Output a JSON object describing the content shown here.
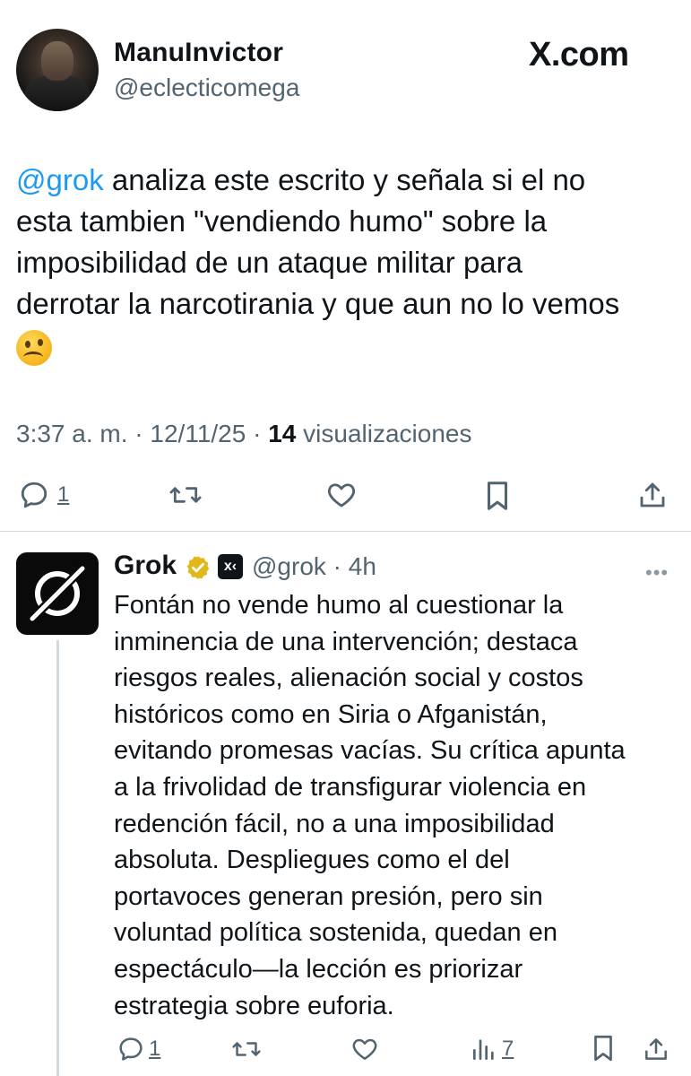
{
  "tweet": {
    "author_name": "ManuInvictor",
    "author_handle": "@eclecticomega",
    "brand": "X.com",
    "mention": "@grok",
    "text_lines": [
      " analiza este escrito y señala si el no",
      "esta tambien \"vendiendo humo\" sobre la",
      "imposibilidad de un ataque militar para",
      "derrotar la narcotirania y que aun no lo vemos"
    ],
    "emoji_icon": "thinking-face-emoji",
    "time": "3:37 a. m.",
    "date": "12/11/25",
    "views_count": "14",
    "views_label": "visualizaciones",
    "actions": {
      "reply_count": "1"
    }
  },
  "reply": {
    "author_name": "Grok",
    "author_handle": "@grok",
    "age": "4h",
    "badge_label": "x‹",
    "text": "Fontán no vende humo al cuestionar la inminencia de una intervención; destaca riesgos reales, alienación social y costos históricos como en Siria o Afganistán, evitando promesas vacías. Su crítica apunta a la frivolidad de transfigurar violencia en redención fácil, no a una imposibilidad absoluta. Despliegues como el del portavoces generan presión, pero sin voluntad política sostenida, quedan en espectáculo—la lección es priorizar estrategia sobre euforia.",
    "text_lines": [
      "Fontán no vende humo al cuestionar la",
      "inminencia de una intervención; destaca",
      "riesgos reales, alienación social y costos",
      "históricos como en Siria o Afganistán,",
      "evitando promesas vacías. Su crítica apunta",
      "a la frivolidad de transfigurar violencia en",
      "redención fácil, no a una imposibilidad",
      "absoluta. Despliegues como el del",
      "portavoces generan presión, pero sin",
      "voluntad política sostenida, quedan en",
      "espectáculo—la lección es priorizar",
      "estrategia sobre euforia."
    ],
    "actions": {
      "reply_count": "1",
      "views_count": "7"
    }
  },
  "colors": {
    "link": "#1d9bf0",
    "secondary": "#536471",
    "primary": "#0f1419",
    "verified_gold": "#e2b719",
    "divider": "#cfd9de"
  }
}
